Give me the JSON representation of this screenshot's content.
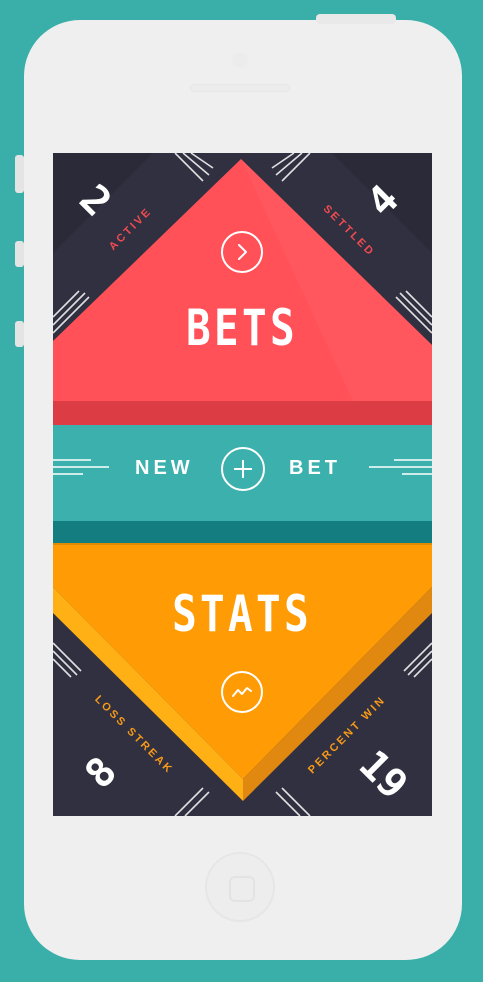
{
  "bets": {
    "title": "BETS",
    "active_count": "2",
    "active_label": "ACTIVE",
    "settled_count": "4",
    "settled_label": "SETTLED",
    "open_icon": "chevron-right-icon"
  },
  "new_bet": {
    "left_label": "NEW",
    "right_label": "BET",
    "icon": "plus-icon"
  },
  "stats": {
    "title": "STATS",
    "loss_streak_value": "8",
    "loss_streak_label": "LOSS STREAK",
    "percent_win_value": "19",
    "percent_win_label": "PERCENT WIN",
    "icon": "trend-line-icon"
  },
  "colors": {
    "background": "#3aafaa",
    "dark_panel": "#303040",
    "bets_red": "#ff5157",
    "new_bet_teal": "#3bb0ad",
    "stats_orange": "#ff9c05",
    "label_red": "#f04b50",
    "label_orange": "#f79a18"
  }
}
